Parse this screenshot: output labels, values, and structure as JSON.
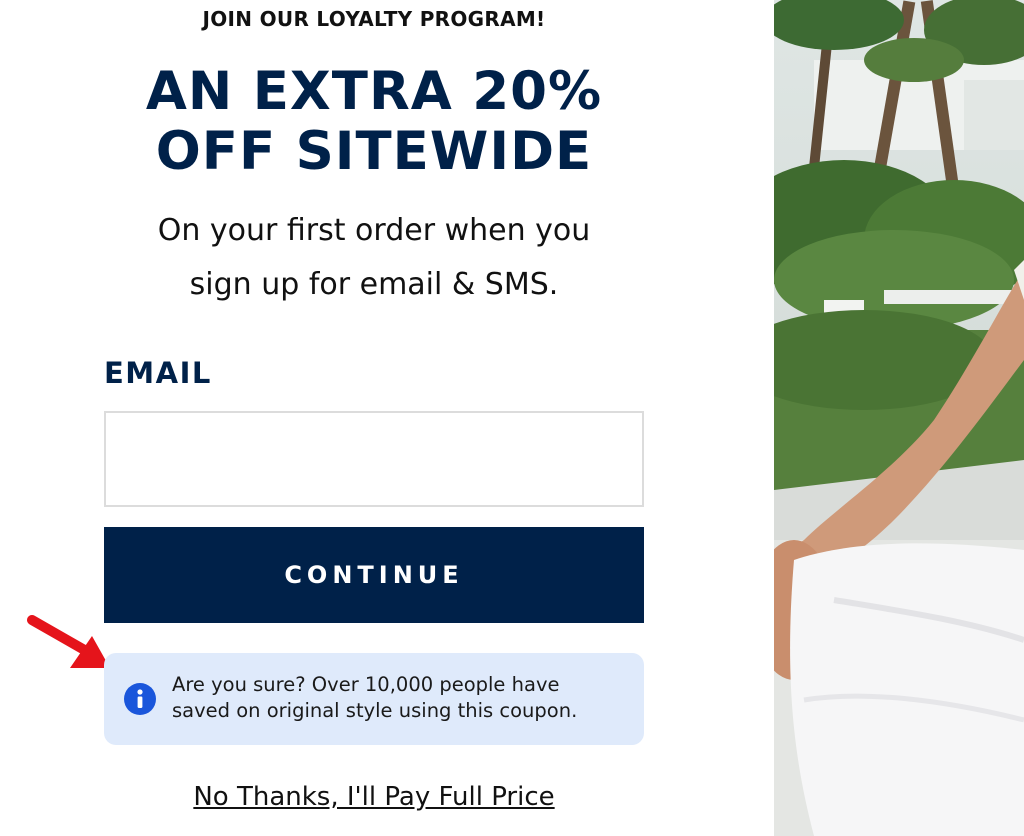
{
  "modal": {
    "eyebrow": "JOIN OUR LOYALTY PROGRAM!",
    "headline_line1": "AN EXTRA 20%",
    "headline_line2": "OFF SITEWIDE",
    "subhead_line1": "On your first order when you",
    "subhead_line2": "sign up for email & SMS.",
    "email_label": "EMAIL",
    "email_value": "",
    "email_placeholder": "",
    "continue_label": "CONTINUE",
    "notice_line1": "Are you sure? Over 10,000 people have",
    "notice_line2": "saved on original style using this coupon.",
    "decline_link": "No Thanks, I'll Pay Full Price"
  },
  "colors": {
    "brand_navy": "#002149",
    "notice_bg": "#dfeafb",
    "info_blue": "#1a56db",
    "arrow_red": "#e5141b"
  },
  "icons": {
    "info": "info-icon",
    "annotation": "red-arrow-icon"
  }
}
